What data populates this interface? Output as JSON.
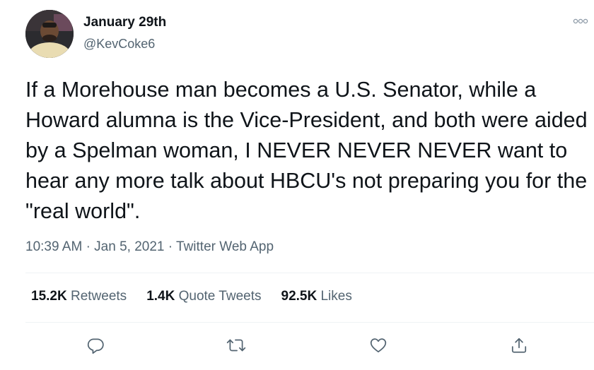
{
  "author": {
    "display_name": "January 29th",
    "handle": "@KevCoke6"
  },
  "tweet": {
    "text": "If a Morehouse man becomes a U.S. Senator, while a Howard alumna is the Vice-President, and both were aided by a Spelman woman, I NEVER NEVER NEVER want to hear any more talk about HBCU's not preparing you for the \"real world\".",
    "time": "10:39 AM",
    "date": "Jan 5, 2021",
    "source": "Twitter Web App",
    "separator": "·"
  },
  "stats": {
    "retweets_count": "15.2K",
    "retweets_label": "Retweets",
    "quotes_count": "1.4K",
    "quotes_label": "Quote Tweets",
    "likes_count": "92.5K",
    "likes_label": "Likes"
  },
  "icons": {
    "more": "more-options-icon",
    "reply": "reply-icon",
    "retweet": "retweet-icon",
    "like": "like-icon",
    "share": "share-icon"
  },
  "colors": {
    "text_primary": "#0f1419",
    "text_secondary": "#536471",
    "divider": "#eff3f4"
  }
}
